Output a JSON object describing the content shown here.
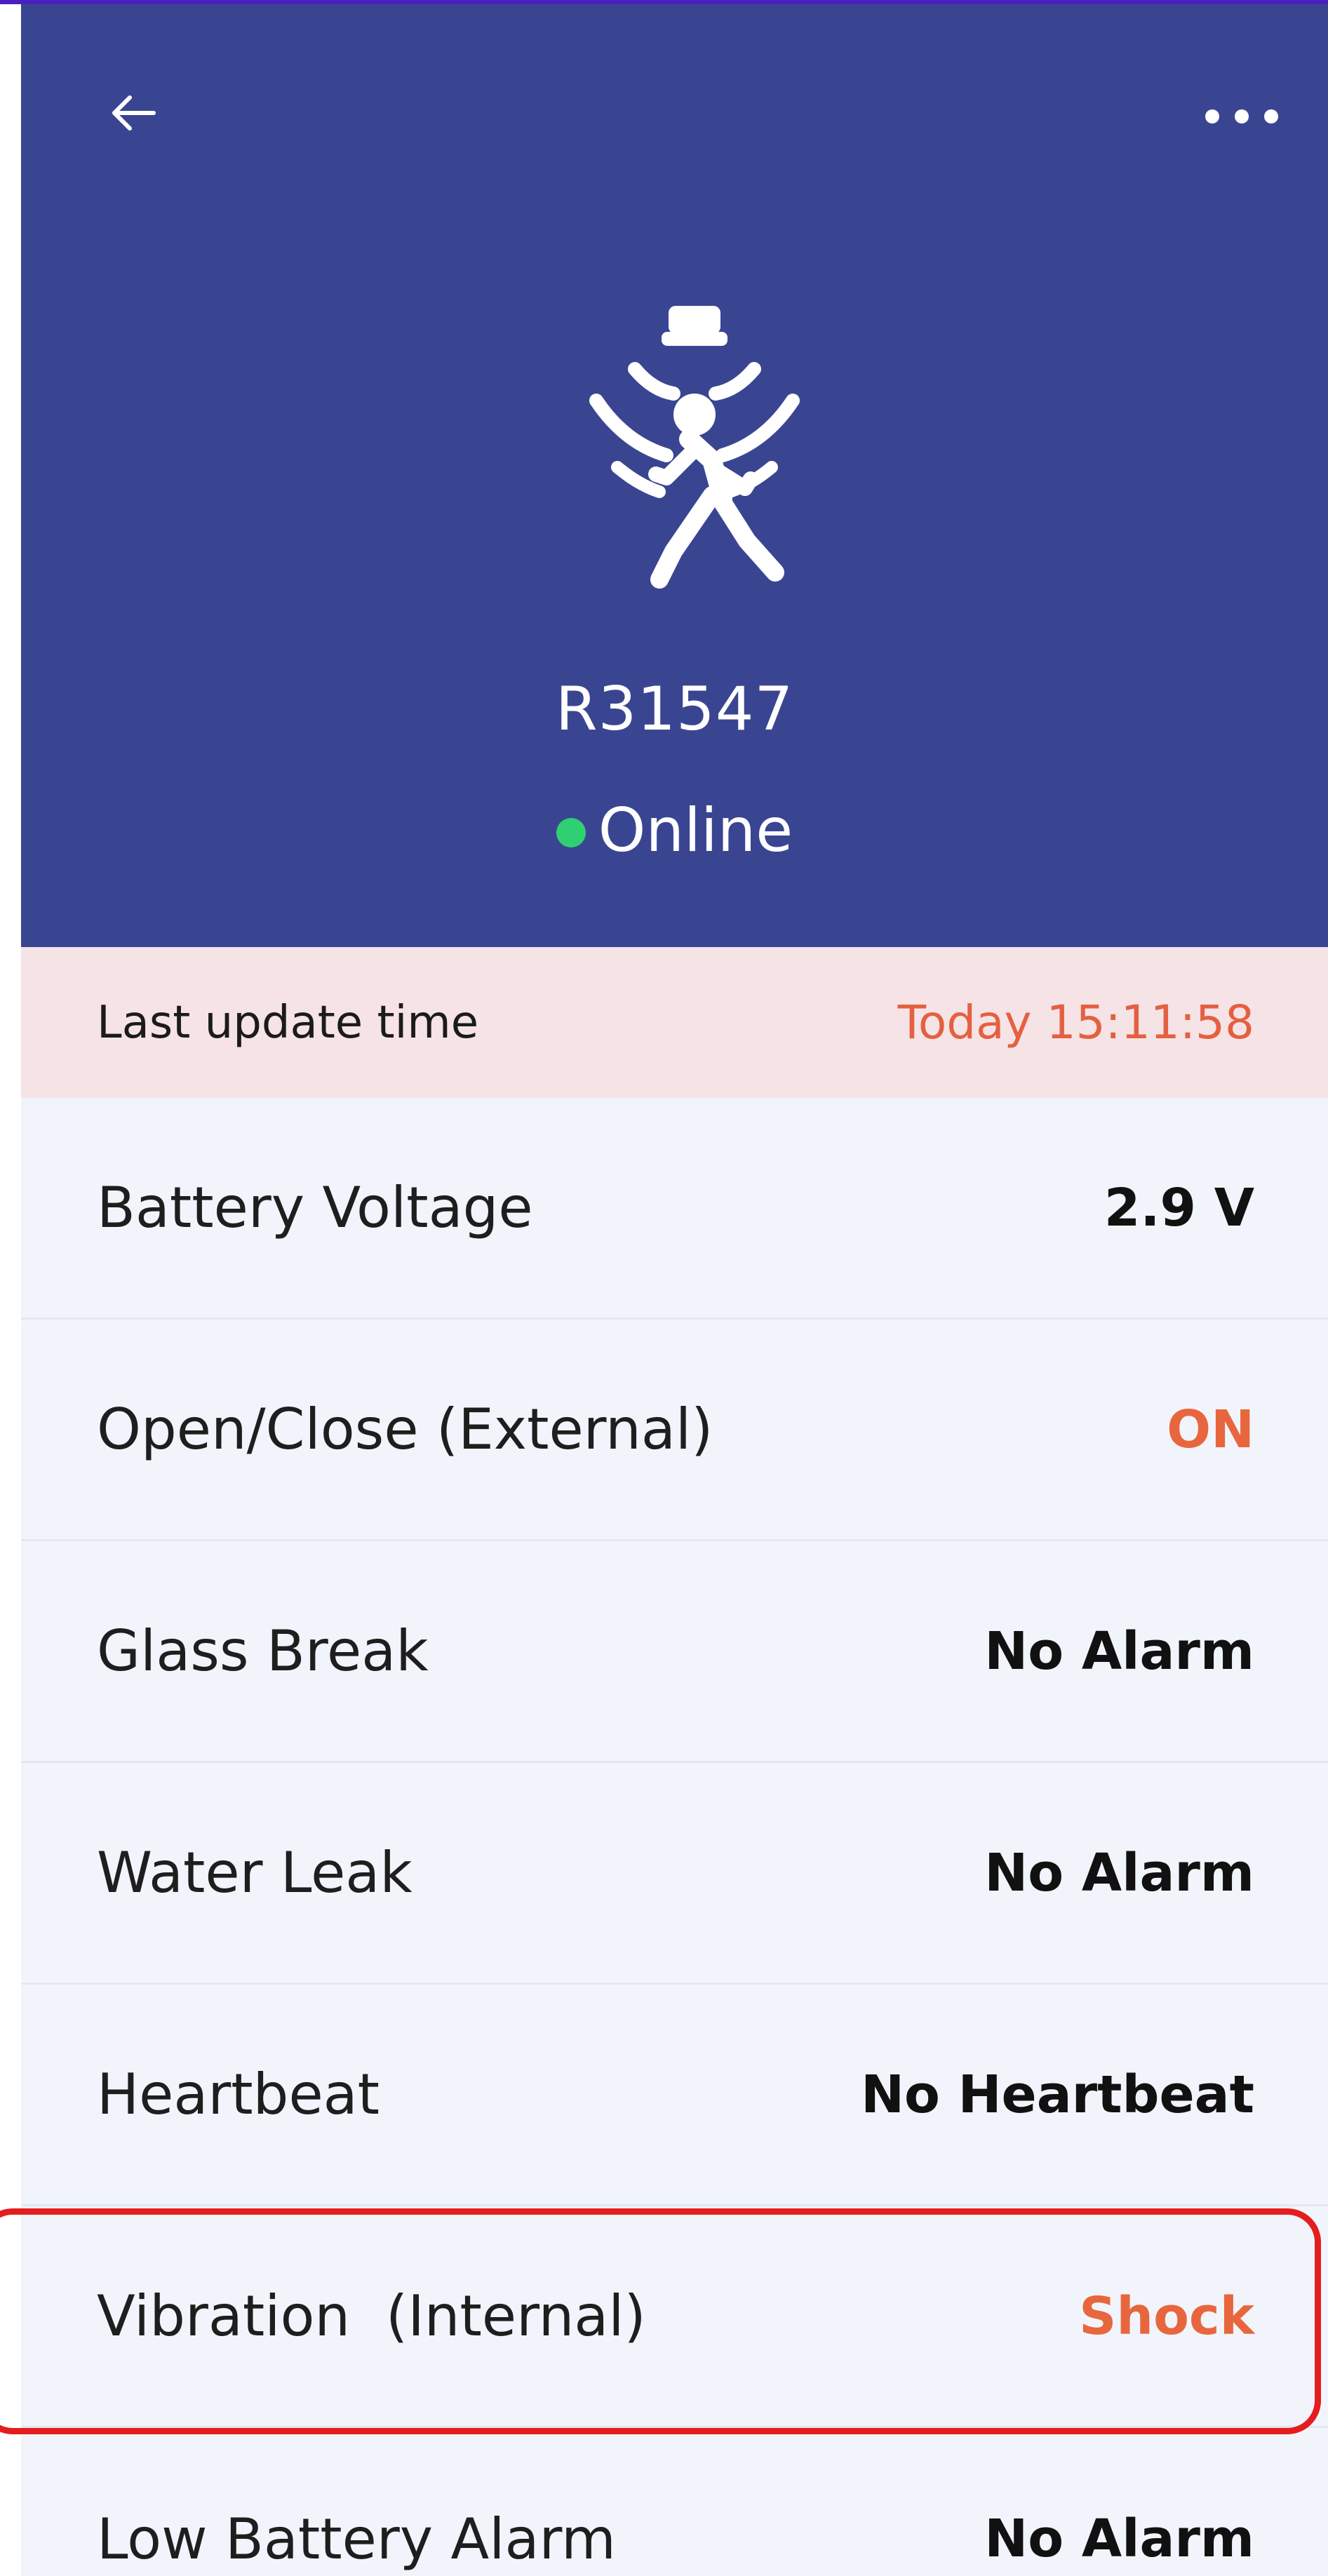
{
  "header": {
    "device_name": "R31547",
    "status_text": "Online",
    "status_color": "#2fd071",
    "back_icon": "arrow-left-icon",
    "more_icon": "more-horizontal-icon",
    "device_icon": "motion-sensor-person-icon"
  },
  "update": {
    "label": "Last update time",
    "value": "Today 15:11:58",
    "value_color": "#e46040",
    "background": "#f5e3e6"
  },
  "rows": [
    {
      "label": "Battery Voltage",
      "value": "2.9 V",
      "value_color": "#111111"
    },
    {
      "label": "Open/Close (External)",
      "value": "ON",
      "value_color": "#e8663d"
    },
    {
      "label": "Glass Break",
      "value": "No Alarm",
      "value_color": "#111111"
    },
    {
      "label": "Water Leak",
      "value": "No Alarm",
      "value_color": "#111111"
    },
    {
      "label": "Heartbeat",
      "value": "No Heartbeat",
      "value_color": "#111111"
    },
    {
      "label": "Vibration  (Internal)",
      "value": "Shock",
      "value_color": "#e8663d"
    },
    {
      "label": "Low Battery Alarm",
      "value": "No Alarm",
      "value_color": "#111111"
    }
  ],
  "colors": {
    "header_bg": "#3a4592",
    "list_bg": "#f2f4fb",
    "highlight_border": "#e41d1d"
  }
}
